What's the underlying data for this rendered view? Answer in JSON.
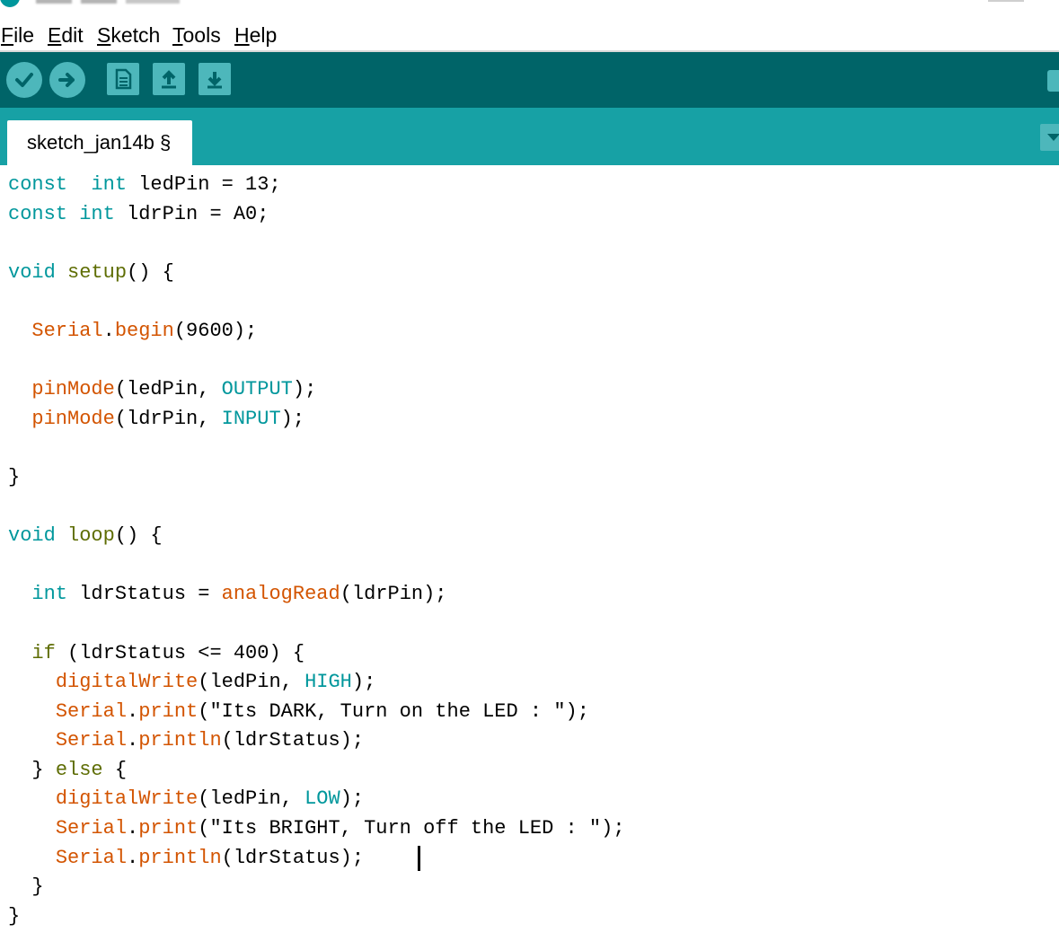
{
  "menu": {
    "items": [
      {
        "first": "F",
        "rest": "ile"
      },
      {
        "first": "E",
        "rest": "dit"
      },
      {
        "first": "S",
        "rest": "ketch"
      },
      {
        "first": "T",
        "rest": "ools"
      },
      {
        "first": "H",
        "rest": "elp"
      }
    ]
  },
  "toolbar": {
    "buttons": [
      "verify-button",
      "upload-button",
      "new-button",
      "open-button",
      "save-button"
    ]
  },
  "tabs": {
    "active_label": "sketch_jan14b §"
  },
  "code": {
    "lines": [
      [
        [
          "kw",
          "const"
        ],
        [
          "",
          "  "
        ],
        [
          "kw",
          "int"
        ],
        [
          "",
          " ledPin = 13;"
        ]
      ],
      [
        [
          "kw",
          "const"
        ],
        [
          "",
          ""
        ],
        [
          "kw",
          " int"
        ],
        [
          "",
          " ldrPin = A0;"
        ]
      ],
      [],
      [
        [
          "kw",
          "void"
        ],
        [
          "ctl",
          " setup"
        ],
        [
          "",
          "() {"
        ]
      ],
      [],
      [
        [
          "",
          "  "
        ],
        [
          "fn",
          "Serial"
        ],
        [
          "",
          "."
        ],
        [
          "fn",
          "begin"
        ],
        [
          "",
          "(9600);"
        ]
      ],
      [],
      [
        [
          "",
          "  "
        ],
        [
          "fn",
          "pinMode"
        ],
        [
          "",
          "(ledPin, "
        ],
        [
          "cst",
          "OUTPUT"
        ],
        [
          "",
          ");"
        ]
      ],
      [
        [
          "",
          "  "
        ],
        [
          "fn",
          "pinMode"
        ],
        [
          "",
          "(ldrPin, "
        ],
        [
          "cst",
          "INPUT"
        ],
        [
          "",
          ");"
        ]
      ],
      [],
      [
        [
          "",
          "}"
        ]
      ],
      [],
      [
        [
          "kw",
          "void"
        ],
        [
          "ctl",
          " loop"
        ],
        [
          "",
          "() {"
        ]
      ],
      [],
      [
        [
          "",
          "  "
        ],
        [
          "kw",
          "int"
        ],
        [
          "",
          " ldrStatus = "
        ],
        [
          "fn",
          "analogRead"
        ],
        [
          "",
          "(ldrPin);"
        ]
      ],
      [],
      [
        [
          "",
          "  "
        ],
        [
          "ctl",
          "if"
        ],
        [
          "",
          " (ldrStatus <= 400) {"
        ]
      ],
      [
        [
          "",
          "    "
        ],
        [
          "fn",
          "digitalWrite"
        ],
        [
          "",
          "(ledPin, "
        ],
        [
          "cst",
          "HIGH"
        ],
        [
          "",
          ");"
        ]
      ],
      [
        [
          "",
          "    "
        ],
        [
          "fn",
          "Serial"
        ],
        [
          "",
          "."
        ],
        [
          "fn",
          "print"
        ],
        [
          "",
          "(\"Its DARK, Turn on the LED : \");"
        ]
      ],
      [
        [
          "",
          "    "
        ],
        [
          "fn",
          "Serial"
        ],
        [
          "",
          "."
        ],
        [
          "fn",
          "println"
        ],
        [
          "",
          "(ldrStatus);"
        ]
      ],
      [
        [
          "",
          "  } "
        ],
        [
          "ctl",
          "else"
        ],
        [
          "",
          " {"
        ]
      ],
      [
        [
          "",
          "    "
        ],
        [
          "fn",
          "digitalWrite"
        ],
        [
          "",
          "(ledPin, "
        ],
        [
          "cst",
          "LOW"
        ],
        [
          "",
          ");"
        ]
      ],
      [
        [
          "",
          "    "
        ],
        [
          "fn",
          "Serial"
        ],
        [
          "",
          "."
        ],
        [
          "fn",
          "print"
        ],
        [
          "",
          "(\"Its BRIGHT, Turn off the LED : \");"
        ]
      ],
      [
        [
          "",
          "    "
        ],
        [
          "fn",
          "Serial"
        ],
        [
          "",
          "."
        ],
        [
          "fn",
          "println"
        ],
        [
          "",
          "(ldrStatus);"
        ]
      ],
      [
        [
          "",
          "  }"
        ]
      ],
      [
        [
          "",
          "}"
        ]
      ]
    ]
  },
  "colors": {
    "toolbar_bg": "#006468",
    "tabbar_bg": "#17a1a5",
    "button_bg": "#4db7bb",
    "keyword": "#00979c",
    "function": "#d35400",
    "control": "#5e6d03"
  }
}
